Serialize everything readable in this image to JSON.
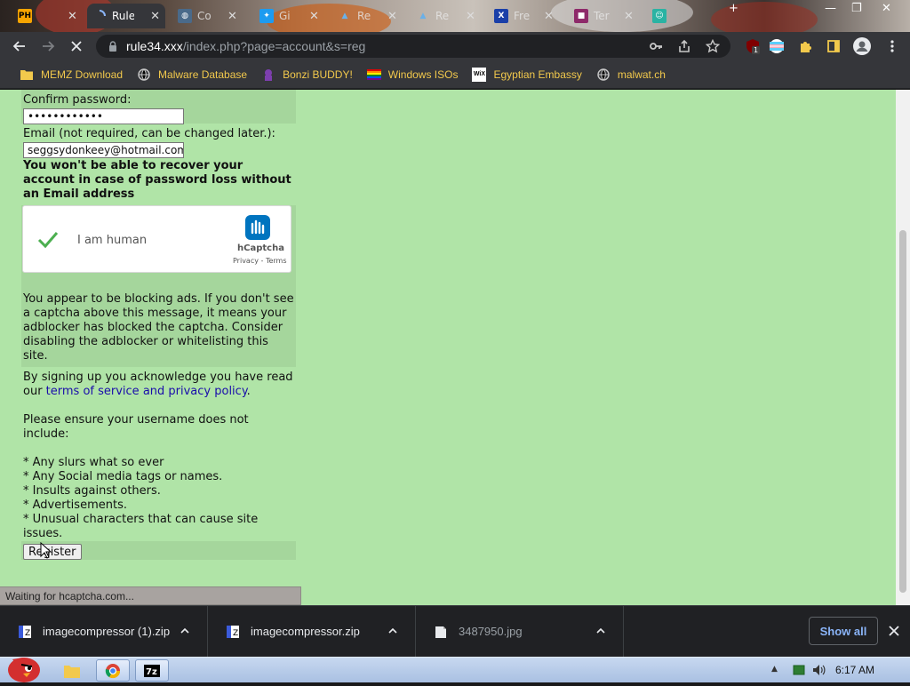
{
  "tabs": [
    {
      "title": "",
      "favicon": "ph-icon"
    },
    {
      "title": "Rule",
      "favicon": "loading-spinner-icon",
      "active": true
    },
    {
      "title": "Co",
      "favicon": "globe-icon"
    },
    {
      "title": "Gi",
      "favicon": "bird-icon"
    },
    {
      "title": "Re",
      "favicon": "triangle-icon"
    },
    {
      "title": "Re",
      "favicon": "triangle-icon"
    },
    {
      "title": "Fre",
      "favicon": "x-icon"
    },
    {
      "title": "Ter",
      "favicon": "square-icon"
    },
    {
      "title": "",
      "favicon": "face-icon"
    }
  ],
  "address_bar": {
    "host": "rule34.xxx",
    "path": "/index.php?page=account&s=reg"
  },
  "extensions": {
    "ublock_badge": "1"
  },
  "bookmarks": [
    {
      "label": "MEMZ Download",
      "icon": "folder-icon"
    },
    {
      "label": "Malware Database",
      "icon": "globe-icon"
    },
    {
      "label": "Bonzi BUDDY!",
      "icon": "bonzi-icon"
    },
    {
      "label": "Windows ISOs",
      "icon": "rainbow-flag-icon"
    },
    {
      "label": "Egyptian Embassy",
      "icon": "wix-icon"
    },
    {
      "label": "malwat.ch",
      "icon": "globe-icon"
    }
  ],
  "form": {
    "confirm_password_label": "Confirm password:",
    "confirm_password_value": "••••••••••••",
    "email_label": "Email (not required, can be changed later.):",
    "email_value": "seggsydonkeey@hotmail.com",
    "email_warning": "You won't be able to recover your account in case of password loss without an Email address",
    "captcha": {
      "checkbox_label": "I am human",
      "brand": "hCaptcha",
      "links": "Privacy - Terms"
    },
    "adblock_notice": "You appear to be blocking ads. If you don't see a captcha above this message, it means your adblocker has blocked the captcha. Consider disabling the adblocker or whitelisting this site.",
    "tos_prefix": "By signing up you acknowledge you have read our ",
    "tos_link": "terms of service and privacy policy",
    "tos_suffix": ".",
    "rules_intro": "Please ensure your username does not include:",
    "rules": [
      "* Any slurs what so ever",
      "* Any Social media tags or names.",
      "* Insults against others.",
      "* Advertisements.",
      "* Unusual characters that can cause site issues."
    ],
    "register_label": "Register"
  },
  "status_text": "Waiting for hcaptcha.com...",
  "downloads": [
    {
      "filename": "imagecompressor (1).zip",
      "icon": "zip-file-icon"
    },
    {
      "filename": "imagecompressor.zip",
      "icon": "zip-file-icon"
    },
    {
      "filename": "3487950.jpg",
      "icon": "image-file-icon"
    }
  ],
  "show_all_label": "Show all",
  "taskbar": {
    "clock": "6:17 AM"
  },
  "colors": {
    "page_bg": "#b0e4a7",
    "form_row_bg": "#a5d69c",
    "link": "#1a0dab",
    "bookmark_text": "#f2c94c"
  }
}
